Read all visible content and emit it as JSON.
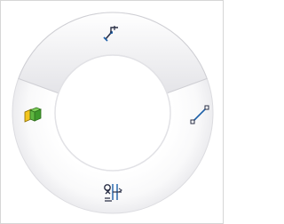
{
  "mouse_gesture_wheel": {
    "active_sector": "top",
    "items": [
      {
        "position": "top",
        "icon": "sketch-icon"
      },
      {
        "position": "left",
        "icon": "parts-3d-icon"
      },
      {
        "position": "right",
        "icon": "line-icon"
      },
      {
        "position": "bottom",
        "icon": "smart-dimension-icon"
      }
    ]
  },
  "colors": {
    "highlight_sector": "#ececef",
    "ring": "#f7f7f8",
    "ring_edge": "#dcdce0",
    "icon_blue": "#1c5fa8",
    "icon_dark": "#2a2f45",
    "icon_green": "#3f9a2c",
    "icon_yellow": "#f2c51f"
  }
}
